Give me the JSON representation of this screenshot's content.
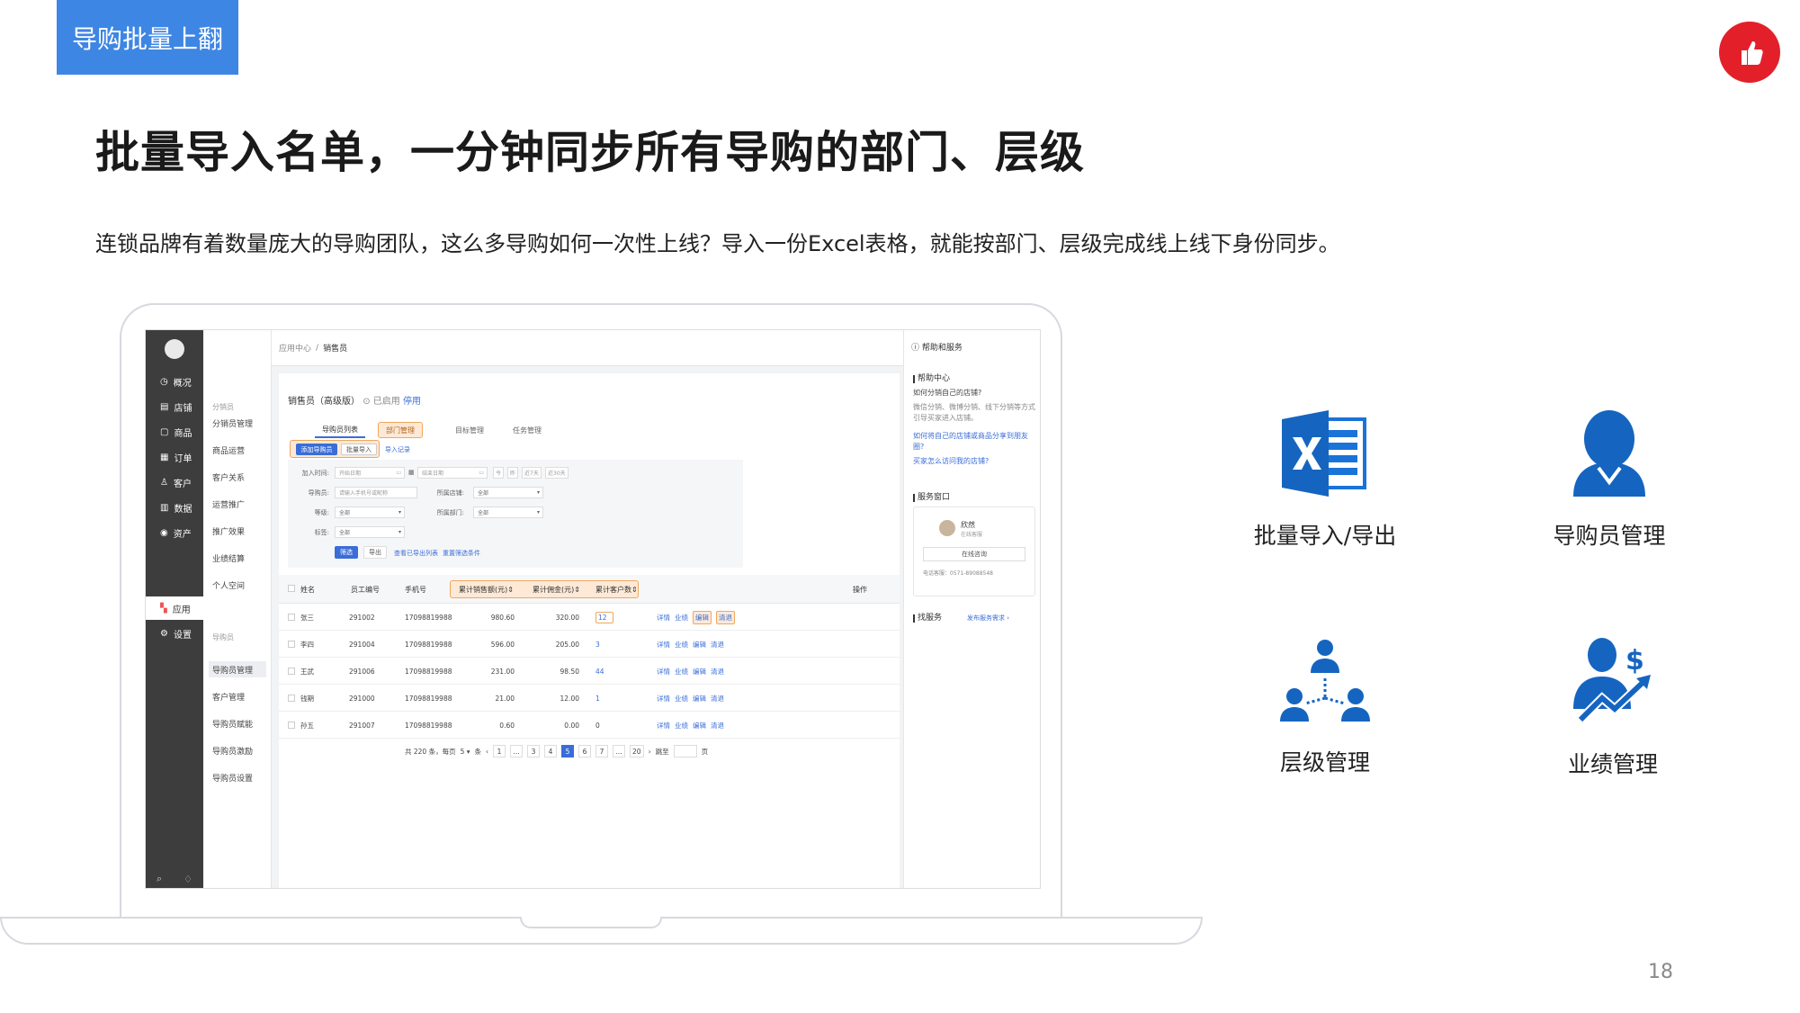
{
  "slide": {
    "tag": "导购批量上翻",
    "headline": "批量导入名单，一分钟同步所有导购的部门、层级",
    "subline": "连锁品牌有着数量庞大的导购团队，这么多导购如何一次性上线？导入一份Excel表格，就能按部门、层级完成线上线下身份同步。",
    "page_number": "18"
  },
  "app": {
    "nav": [
      {
        "label": "概况",
        "icon": "overview-icon"
      },
      {
        "label": "店铺",
        "icon": "store-icon"
      },
      {
        "label": "商品",
        "icon": "goods-icon"
      },
      {
        "label": "订单",
        "icon": "order-icon"
      },
      {
        "label": "客户",
        "icon": "customer-icon"
      },
      {
        "label": "数据",
        "icon": "data-icon"
      },
      {
        "label": "资产",
        "icon": "asset-icon"
      },
      {
        "label": "应用",
        "icon": "apps-icon"
      },
      {
        "label": "设置",
        "icon": "settings-icon"
      }
    ],
    "subnav_group1": "分销员",
    "subnav1": [
      "分销员管理",
      "商品运营",
      "客户关系",
      "运营推广",
      "推广效果",
      "业绩结算",
      "个人空间"
    ],
    "subnav_group2": "导购员",
    "subnav2": [
      "导购员管理",
      "客户管理",
      "导购员赋能",
      "导购员激励",
      "导购员设置"
    ],
    "breadcrumb_root": "应用中心",
    "breadcrumb_sep": "/",
    "breadcrumb_current": "销售员",
    "help_center_title": "帮助和服务",
    "help": {
      "section1": "帮助中心",
      "q1": "如何分销自己的店铺?",
      "a1": "微信分销、微博分销、线下分销等方式引导买家进入店铺。",
      "link1": "如何将自己的店铺或商品分享到朋友圈?",
      "link2": "买家怎么访问我的店铺?",
      "section2": "服务窗口",
      "agent_name": "欣然",
      "agent_status": "在线客服",
      "consult_button": "在线咨询",
      "hotline": "电话客服：0571-89088548",
      "section3": "找服务",
      "service_link": "发布服务需求 ›"
    },
    "main": {
      "title": "销售员（高级版）",
      "status": "已启用",
      "disable": "停用",
      "tabs": [
        "导购员列表",
        "部门管理",
        "目标管理",
        "任务管理"
      ],
      "subtabs": [
        "添加导购员",
        "批量导入",
        "导入记录"
      ],
      "filters": {
        "join_time_label": "加入时间:",
        "start_placeholder": "开始日期",
        "end_placeholder": "结束日期",
        "quick": [
          "今",
          "昨",
          "近7天",
          "近30天"
        ],
        "guide_label": "导购员:",
        "guide_placeholder": "请输入手机号或昵称",
        "store_label": "所属店铺:",
        "store_value": "全部",
        "level_label": "等级:",
        "level_value": "全部",
        "dept_label": "所属部门:",
        "dept_value": "全部",
        "tag_label": "标签:",
        "tag_value": "全部",
        "filter_button": "筛选",
        "export_button": "导出",
        "view_export": "查看已导出列表",
        "reset": "重置筛选条件"
      },
      "table": {
        "headers": [
          "姓名",
          "员工编号",
          "手机号",
          "累计销售额(元)",
          "累计佣金(元)",
          "累计客户数",
          "操作"
        ],
        "rows": [
          {
            "name": "张三",
            "id": "291002",
            "phone": "17098819988",
            "sales": "980.60",
            "commission": "320.00",
            "customers": "12"
          },
          {
            "name": "李四",
            "id": "291004",
            "phone": "17098819988",
            "sales": "596.00",
            "commission": "205.00",
            "customers": "3"
          },
          {
            "name": "王武",
            "id": "291006",
            "phone": "17098819988",
            "sales": "231.00",
            "commission": "98.50",
            "customers": "44"
          },
          {
            "name": "钱期",
            "id": "291000",
            "phone": "17098819988",
            "sales": "21.00",
            "commission": "12.00",
            "customers": "1"
          },
          {
            "name": "孙五",
            "id": "291007",
            "phone": "17098819988",
            "sales": "0.60",
            "commission": "0.00",
            "customers": "0"
          }
        ],
        "actions": [
          "详情",
          "业绩",
          "编辑",
          "清退"
        ]
      },
      "pager": {
        "total": "共 220 条，每页",
        "per_page": "5",
        "unit": "条",
        "pages": [
          "1",
          "...",
          "3",
          "4",
          "5",
          "6",
          "7",
          "...",
          "20"
        ],
        "current": "5",
        "goto": "跳至",
        "page_unit": "页"
      }
    }
  },
  "features": [
    {
      "label": "批量导入/导出",
      "icon": "excel-icon"
    },
    {
      "label": "导购员管理",
      "icon": "person-icon"
    },
    {
      "label": "层级管理",
      "icon": "hierarchy-icon"
    },
    {
      "label": "业绩管理",
      "icon": "performance-icon"
    }
  ],
  "colors": {
    "accent": "#3e86e3",
    "brand_red": "#e3202a",
    "icon_blue": "#1565c0",
    "highlight": "#f0a75c"
  }
}
